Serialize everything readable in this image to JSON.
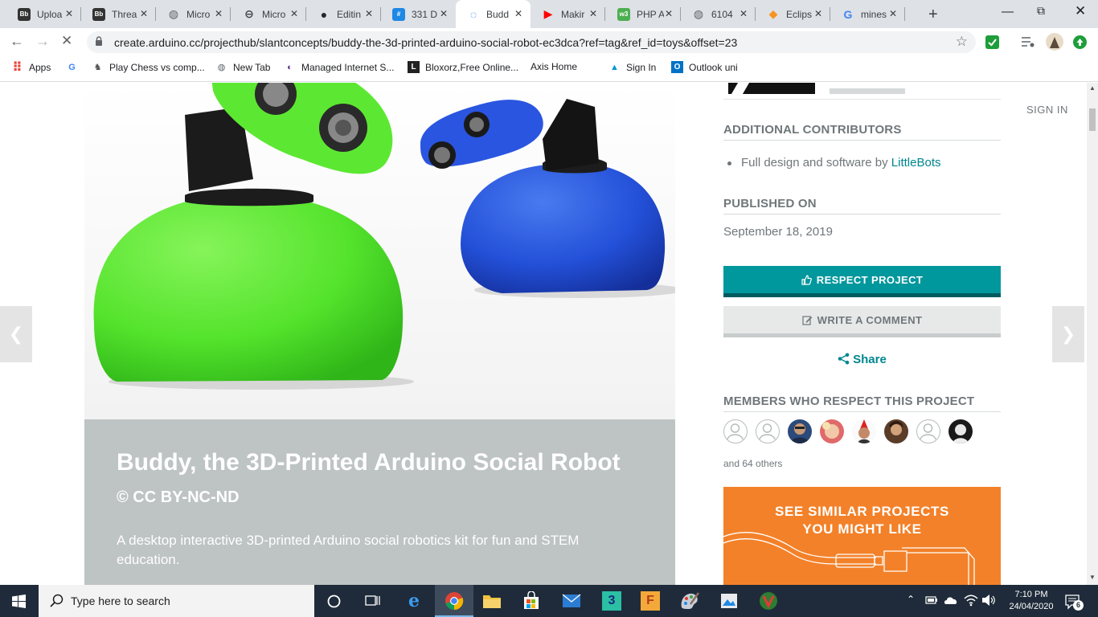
{
  "browser": {
    "tabs": [
      {
        "label": "Uploa",
        "icon": "blackboard-icon",
        "color": "#333333",
        "glyph": "Bb"
      },
      {
        "label": "Threa",
        "icon": "blackboard-icon",
        "color": "#333333",
        "glyph": "Bb"
      },
      {
        "label": "Micro",
        "icon": "globe-icon",
        "color": "#5f6368",
        "glyph": "◍"
      },
      {
        "label": "Micro",
        "icon": "link-icon",
        "color": "#3c4043",
        "glyph": "⊖"
      },
      {
        "label": "Editin",
        "icon": "github-icon",
        "color": "#24292e",
        "glyph": "●"
      },
      {
        "label": "331 D",
        "icon": "hashtag-icon",
        "color": "#1e88e5",
        "glyph": "#"
      },
      {
        "label": "Budd",
        "icon": "loading-spinner-icon",
        "color": "#1a73e8",
        "glyph": "◌"
      },
      {
        "label": "Makir",
        "icon": "youtube-icon",
        "color": "#ff0000",
        "glyph": "▶"
      },
      {
        "label": "PHP A",
        "icon": "w3schools-icon",
        "color": "#4caf50",
        "glyph": "w3"
      },
      {
        "label": "6104",
        "icon": "globe-icon",
        "color": "#5f6368",
        "glyph": "◍"
      },
      {
        "label": "Eclips",
        "icon": "eclipse-icon",
        "color": "#f7941e",
        "glyph": "◆"
      },
      {
        "label": "mines",
        "icon": "google-icon",
        "color": "#4285f4",
        "glyph": "G"
      }
    ],
    "active_tab": 6,
    "url": "create.arduino.cc/projecthub/slantconcepts/buddy-the-3d-printed-arduino-social-robot-ec3dca?ref=tag&ref_id=toys&offset=23",
    "bookmarks": [
      {
        "label": "Apps",
        "icon": "apps-grid-icon",
        "color": "#ea4335",
        "glyph": "⠿"
      },
      {
        "label": "",
        "icon": "google-icon",
        "color": "#4285f4",
        "glyph": "G"
      },
      {
        "label": "Play Chess vs comp...",
        "icon": "chess-icon",
        "color": "#555555",
        "glyph": "♞"
      },
      {
        "label": "New Tab",
        "icon": "globe-icon",
        "color": "#5f6368",
        "glyph": "◍"
      },
      {
        "label": "Managed Internet S...",
        "icon": "managed-service-icon",
        "color": "#5b2c83",
        "glyph": "◐"
      },
      {
        "label": "Bloxorz,Free Online...",
        "icon": "bloxorz-icon",
        "color": "#222222",
        "glyph": "L"
      },
      {
        "label": "Axis Home",
        "icon": "",
        "color": "#ffffff",
        "glyph": ""
      },
      {
        "label": "Sign In",
        "icon": "autodesk-icon",
        "color": "#0696d7",
        "glyph": "▲"
      },
      {
        "label": "Outlook uni",
        "icon": "outlook-icon",
        "color": "#0072c6",
        "glyph": "O"
      }
    ]
  },
  "page": {
    "sign_in": "SIGN IN",
    "additional_contributors": {
      "heading": "ADDITIONAL CONTRIBUTORS",
      "item_text": "Full design and software by ",
      "item_link": "LittleBots"
    },
    "published": {
      "heading": "PUBLISHED ON",
      "date": "September 18, 2019"
    },
    "respect_button": "RESPECT PROJECT",
    "comment_button": "WRITE A COMMENT",
    "share_link": "Share",
    "members": {
      "heading": "MEMBERS WHO RESPECT THIS PROJECT",
      "others": "and 64 others"
    },
    "similar": {
      "line1": "SEE SIMILAR PROJECTS",
      "line2": "YOU MIGHT LIKE"
    },
    "project": {
      "title": "Buddy, the 3D-Printed Arduino Social Robot",
      "license": "© CC BY-NC-ND",
      "description": "A desktop interactive 3D-printed Arduino social robotics kit for fun and STEM education."
    }
  },
  "taskbar": {
    "search_placeholder": "Type here to search",
    "time": "7:10 PM",
    "date": "24/04/2020",
    "notifications": "6"
  },
  "colors": {
    "accent_teal": "#00979d",
    "orange": "#f38129",
    "title_panel": "#bec3c3",
    "robot_green": "#54e32c",
    "robot_blue": "#2350d8"
  }
}
